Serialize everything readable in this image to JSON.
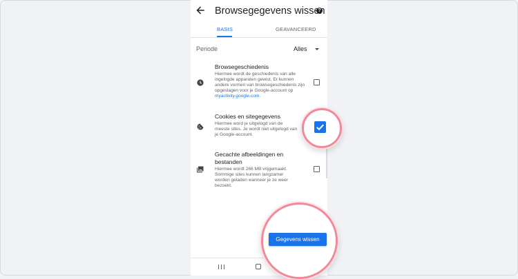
{
  "header": {
    "title": "Browsegegevens wissen",
    "back_icon": "arrow-left-icon",
    "help_icon": "help-circle-icon",
    "help_glyph": "?"
  },
  "tabs": [
    {
      "label": "BASIS",
      "selected": true
    },
    {
      "label": "GEAVANCEERD",
      "selected": false
    }
  ],
  "period": {
    "label": "Periode",
    "value": "Alles"
  },
  "items": [
    {
      "icon": "clock-icon",
      "title": "Browsegeschiedenis",
      "description": "Hiermee wordt de geschiedenis van alle ingelogde apparaten gewist. Er kunnen andere vormen van browsegeschiedenis zijn opgeslagen voor je Google-account op",
      "link": "myactivity.google.com",
      "link_suffix": ".",
      "checked": false
    },
    {
      "icon": "cookie-icon",
      "title": "Cookies en sitegegevens",
      "description": "Hiermee word je uitgelogd van de meeste sites. Je wordt niet uitgelogd van je Google-account.",
      "checked": true
    },
    {
      "icon": "image-icon",
      "title": "Gecachte afbeeldingen en bestanden",
      "description": "Hiermee wordt 266 MB vrijgemaakt. Sommige sites kunnen langzamer worden geladen wanneer je ze weer bezoekt.",
      "checked": false
    }
  ],
  "action": {
    "clear_label": "Gegevens wissen"
  },
  "colors": {
    "accent": "#1a73e8",
    "highlight_ring": "#f08a98",
    "background": "#f1f2f5"
  }
}
